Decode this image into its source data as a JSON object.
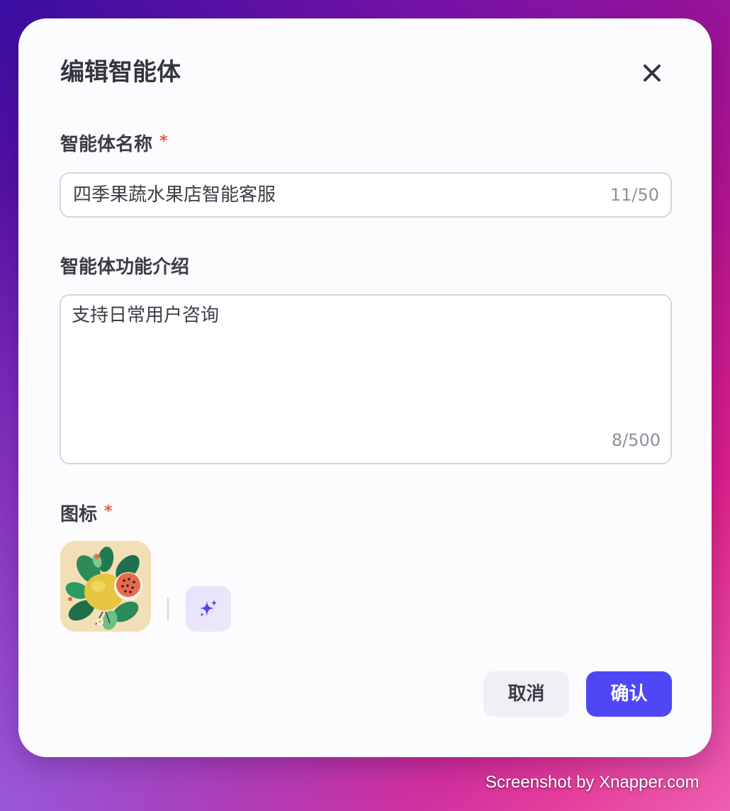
{
  "dialog": {
    "title": "编辑智能体",
    "name_label": "智能体名称",
    "required_mark": "*",
    "name_value": "四季果蔬水果店智能客服",
    "name_counter": "11/50",
    "desc_label": "智能体功能介绍",
    "desc_value": "支持日常用户咨询",
    "desc_counter": "8/500",
    "icon_label": "图标",
    "cancel_label": "取消",
    "confirm_label": "确认"
  },
  "colors": {
    "primary": "#4f47f5",
    "required": "#f05a3a",
    "cancel_bg": "#efeff5"
  },
  "icons": {
    "close": "close-icon",
    "ai_generate": "sparkle-icon",
    "agent_avatar": "fruit-illustration"
  },
  "watermark": "Screenshot by Xnapper.com"
}
